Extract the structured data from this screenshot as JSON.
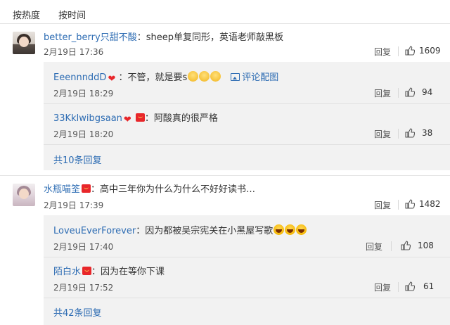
{
  "sort": {
    "hot": "按热度",
    "time": "按时间"
  },
  "labels": {
    "reply": "回复"
  },
  "comments": [
    {
      "username": "better_berry只甜不酸",
      "sep": "：",
      "text": "sheep单复同形，英语老师敲黑板",
      "time": "2月19日 17:36",
      "likes": "1609",
      "replies": [
        {
          "username": "EeennnddD",
          "sep": "：",
          "text": "不管，就是要s",
          "emoji": [
            "dizzy-face-icon",
            "dizzy-face-icon",
            "dizzy-face-icon"
          ],
          "pic_link": "评论配图",
          "time": "2月19日 18:29",
          "likes": "94"
        },
        {
          "username": "33Kklwibgsaan",
          "sep": "：",
          "text": "阿酸真的很严格",
          "time": "2月19日 18:20",
          "likes": "38"
        }
      ],
      "more": "共10条回复"
    },
    {
      "username": "水瓶喵筌",
      "sep": "：",
      "text": "高中三年你为什么为什么不好好读书…",
      "time": "2月19日 17:39",
      "likes": "1482",
      "replies": [
        {
          "username": "LoveuEverForever",
          "sep": "：",
          "text": "因为都被吴宗宪关在小黑屋写歌",
          "emoji": [
            "laughing-face-icon",
            "laughing-face-icon",
            "laughing-face-icon"
          ],
          "time": "2月19日 17:40",
          "likes": "108"
        },
        {
          "username": "陌白水",
          "sep": "：",
          "text": "因为在等你下课",
          "time": "2月19日 17:52",
          "likes": "61"
        }
      ],
      "more": "共42条回复"
    }
  ],
  "colors": {
    "link": "#2d6cb3",
    "reply_bg": "#f2f2f2",
    "badge": "#e8262a"
  }
}
